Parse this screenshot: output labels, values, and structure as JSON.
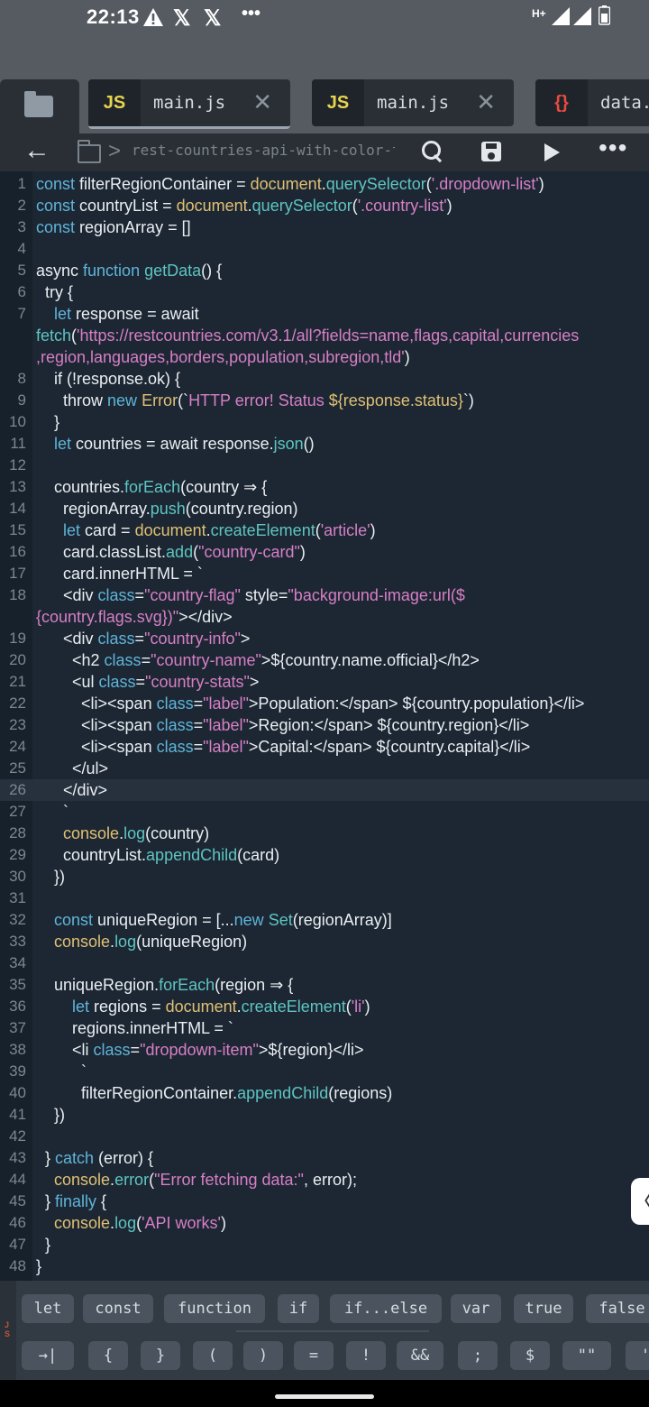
{
  "status_bar": {
    "time": "22:13",
    "icons": [
      "warning-icon",
      "x-app-icon",
      "x-app-icon",
      "more-dots-icon",
      "data-arrows-icon",
      "signal-icon",
      "signal-icon",
      "battery-icon"
    ],
    "more": "•••",
    "network": "H+"
  },
  "tabs": [
    {
      "type": "JS",
      "name": "main.js",
      "close": "✕"
    },
    {
      "type": "JS",
      "name": "main.js",
      "close": "✕"
    },
    {
      "type": "{}",
      "name": "data."
    }
  ],
  "toolbar": {
    "back": "←",
    "chevron": ">",
    "path": "rest-countries-api-with-color-theme-switcher",
    "more": "•••"
  },
  "code_lines": [
    {
      "n": "1",
      "tokens": [
        [
          "const ",
          "kw"
        ],
        [
          "filterRegionContainer = ",
          "pl"
        ],
        [
          "document",
          "obj"
        ],
        [
          ".",
          "pl"
        ],
        [
          "querySelector",
          "fn"
        ],
        [
          "(",
          "pl"
        ],
        [
          "'.dropdown-list'",
          "str"
        ],
        [
          ")",
          "pl"
        ]
      ]
    },
    {
      "n": "2",
      "tokens": [
        [
          "const ",
          "kw"
        ],
        [
          "countryList = ",
          "pl"
        ],
        [
          "document",
          "obj"
        ],
        [
          ".",
          "pl"
        ],
        [
          "querySelector",
          "fn"
        ],
        [
          "(",
          "pl"
        ],
        [
          "'.country-list'",
          "str"
        ],
        [
          ")",
          "pl"
        ]
      ]
    },
    {
      "n": "3",
      "tokens": [
        [
          "const ",
          "kw"
        ],
        [
          "regionArray = []",
          "pl"
        ]
      ]
    },
    {
      "n": "4",
      "tokens": []
    },
    {
      "n": "5",
      "tokens": [
        [
          "async ",
          "pl"
        ],
        [
          "function ",
          "kw"
        ],
        [
          "getData",
          "fn"
        ],
        [
          "() {",
          "pl"
        ]
      ]
    },
    {
      "n": "6",
      "tokens": [
        [
          "  try {",
          "pl"
        ]
      ]
    },
    {
      "n": "7",
      "tokens": [
        [
          "    let ",
          "kw"
        ],
        [
          "response = await",
          "pl"
        ]
      ]
    },
    {
      "n": "",
      "tokens": [
        [
          "fetch",
          "fn"
        ],
        [
          "(",
          "pl"
        ],
        [
          "'https://restcountries.com/v3.1/all?fields=name,flags,capital,currencies",
          "str"
        ]
      ]
    },
    {
      "n": "",
      "tokens": [
        [
          ",region,languages,borders,population,subregion,tld'",
          "str"
        ],
        [
          ")",
          "pl"
        ]
      ]
    },
    {
      "n": "8",
      "tokens": [
        [
          "    if (!response.ok) {",
          "pl"
        ]
      ]
    },
    {
      "n": "9",
      "tokens": [
        [
          "      throw ",
          "pl"
        ],
        [
          "new ",
          "kw"
        ],
        [
          "Error",
          "obj"
        ],
        [
          "(`",
          "pl"
        ],
        [
          "HTTP error! Status ",
          "str"
        ],
        [
          "${response.status}",
          "obj"
        ],
        [
          "`)",
          "pl"
        ]
      ]
    },
    {
      "n": "10",
      "tokens": [
        [
          "    }",
          "pl"
        ]
      ]
    },
    {
      "n": "11",
      "tokens": [
        [
          "    let ",
          "kw"
        ],
        [
          "countries = await response.",
          "pl"
        ],
        [
          "json",
          "fn"
        ],
        [
          "()",
          "pl"
        ]
      ]
    },
    {
      "n": "12",
      "tokens": []
    },
    {
      "n": "13",
      "tokens": [
        [
          "    countries.",
          "pl"
        ],
        [
          "forEach",
          "fn"
        ],
        [
          "(country ⇒ {",
          "pl"
        ]
      ]
    },
    {
      "n": "14",
      "tokens": [
        [
          "      regionArray.",
          "pl"
        ],
        [
          "push",
          "fn"
        ],
        [
          "(country.region)",
          "pl"
        ]
      ]
    },
    {
      "n": "15",
      "tokens": [
        [
          "      let ",
          "kw"
        ],
        [
          "card = ",
          "pl"
        ],
        [
          "document",
          "obj"
        ],
        [
          ".",
          "pl"
        ],
        [
          "createElement",
          "fn"
        ],
        [
          "(",
          "pl"
        ],
        [
          "'article'",
          "str"
        ],
        [
          ")",
          "pl"
        ]
      ]
    },
    {
      "n": "16",
      "tokens": [
        [
          "      card.classList.",
          "pl"
        ],
        [
          "add",
          "fn"
        ],
        [
          "(",
          "pl"
        ],
        [
          "\"country-card\"",
          "str"
        ],
        [
          ")",
          "pl"
        ]
      ]
    },
    {
      "n": "17",
      "tokens": [
        [
          "      card.innerHTML = `",
          "pl"
        ]
      ]
    },
    {
      "n": "18",
      "tokens": [
        [
          "      <div ",
          "pl"
        ],
        [
          "class",
          "kw"
        ],
        [
          "=",
          "pl"
        ],
        [
          "\"country-flag\" ",
          "str"
        ],
        [
          "style",
          "pl"
        ],
        [
          "=",
          "pl"
        ],
        [
          "\"background-image:url($",
          "str"
        ]
      ]
    },
    {
      "n": "",
      "tokens": [
        [
          "{country.flags.svg})\"",
          "str"
        ],
        [
          "></div>",
          "pl"
        ]
      ]
    },
    {
      "n": "19",
      "tokens": [
        [
          "      <div ",
          "pl"
        ],
        [
          "class",
          "kw"
        ],
        [
          "=",
          "pl"
        ],
        [
          "\"country-info\"",
          "str"
        ],
        [
          ">",
          "pl"
        ]
      ]
    },
    {
      "n": "20",
      "tokens": [
        [
          "        <h2 ",
          "pl"
        ],
        [
          "class",
          "kw"
        ],
        [
          "=",
          "pl"
        ],
        [
          "\"country-name\"",
          "str"
        ],
        [
          ">${country.name.official}</h2>",
          "pl"
        ]
      ]
    },
    {
      "n": "21",
      "tokens": [
        [
          "        <ul ",
          "pl"
        ],
        [
          "class",
          "kw"
        ],
        [
          "=",
          "pl"
        ],
        [
          "\"country-stats\"",
          "str"
        ],
        [
          ">",
          "pl"
        ]
      ]
    },
    {
      "n": "22",
      "tokens": [
        [
          "          <li><span ",
          "pl"
        ],
        [
          "class",
          "kw"
        ],
        [
          "=",
          "pl"
        ],
        [
          "\"label\"",
          "str"
        ],
        [
          ">Population:</span> ${country.population}</li>",
          "pl"
        ]
      ]
    },
    {
      "n": "23",
      "tokens": [
        [
          "          <li><span ",
          "pl"
        ],
        [
          "class",
          "kw"
        ],
        [
          "=",
          "pl"
        ],
        [
          "\"label\"",
          "str"
        ],
        [
          ">Region:</span> ${country.region}</li>",
          "pl"
        ]
      ]
    },
    {
      "n": "24",
      "tokens": [
        [
          "          <li><span ",
          "pl"
        ],
        [
          "class",
          "kw"
        ],
        [
          "=",
          "pl"
        ],
        [
          "\"label\"",
          "str"
        ],
        [
          ">Capital:</span> ${country.capital}</li>",
          "pl"
        ]
      ]
    },
    {
      "n": "25",
      "tokens": [
        [
          "        </ul>",
          "pl"
        ]
      ]
    },
    {
      "n": "26",
      "tokens": [
        [
          "      </div>",
          "pl"
        ]
      ],
      "current": true
    },
    {
      "n": "27",
      "tokens": [
        [
          "      `",
          "pl"
        ]
      ]
    },
    {
      "n": "28",
      "tokens": [
        [
          "      console",
          "obj"
        ],
        [
          ".",
          "pl"
        ],
        [
          "log",
          "fn"
        ],
        [
          "(country)",
          "pl"
        ]
      ]
    },
    {
      "n": "29",
      "tokens": [
        [
          "      countryList.",
          "pl"
        ],
        [
          "appendChild",
          "fn"
        ],
        [
          "(card)",
          "pl"
        ]
      ]
    },
    {
      "n": "30",
      "tokens": [
        [
          "    })",
          "pl"
        ]
      ]
    },
    {
      "n": "31",
      "tokens": []
    },
    {
      "n": "32",
      "tokens": [
        [
          "    const ",
          "kw"
        ],
        [
          "uniqueRegion = [...",
          "pl"
        ],
        [
          "new ",
          "kw"
        ],
        [
          "Set",
          "fn"
        ],
        [
          "(regionArray)]",
          "pl"
        ]
      ]
    },
    {
      "n": "33",
      "tokens": [
        [
          "    console",
          "obj"
        ],
        [
          ".",
          "pl"
        ],
        [
          "log",
          "fn"
        ],
        [
          "(uniqueRegion)",
          "pl"
        ]
      ]
    },
    {
      "n": "34",
      "tokens": []
    },
    {
      "n": "35",
      "tokens": [
        [
          "    uniqueRegion.",
          "pl"
        ],
        [
          "forEach",
          "fn"
        ],
        [
          "(region ⇒ {",
          "pl"
        ]
      ]
    },
    {
      "n": "36",
      "tokens": [
        [
          "        let ",
          "kw"
        ],
        [
          "regions = ",
          "pl"
        ],
        [
          "document",
          "obj"
        ],
        [
          ".",
          "pl"
        ],
        [
          "createElement",
          "fn"
        ],
        [
          "(",
          "pl"
        ],
        [
          "'li'",
          "str"
        ],
        [
          ")",
          "pl"
        ]
      ]
    },
    {
      "n": "37",
      "tokens": [
        [
          "        regions.innerHTML = `",
          "pl"
        ]
      ]
    },
    {
      "n": "38",
      "tokens": [
        [
          "        <li ",
          "pl"
        ],
        [
          "class",
          "kw"
        ],
        [
          "=",
          "pl"
        ],
        [
          "\"dropdown-item\"",
          "str"
        ],
        [
          ">${region}</li>",
          "pl"
        ]
      ]
    },
    {
      "n": "39",
      "tokens": [
        [
          "          `",
          "pl"
        ]
      ]
    },
    {
      "n": "40",
      "tokens": [
        [
          "          filterRegionContainer.",
          "pl"
        ],
        [
          "appendChild",
          "fn"
        ],
        [
          "(regions)",
          "pl"
        ]
      ]
    },
    {
      "n": "41",
      "tokens": [
        [
          "    })",
          "pl"
        ]
      ]
    },
    {
      "n": "42",
      "tokens": []
    },
    {
      "n": "43",
      "tokens": [
        [
          "  } ",
          "pl"
        ],
        [
          "catch ",
          "kw"
        ],
        [
          "(error) {",
          "pl"
        ]
      ]
    },
    {
      "n": "44",
      "tokens": [
        [
          "    console",
          "obj"
        ],
        [
          ".",
          "pl"
        ],
        [
          "error",
          "fn"
        ],
        [
          "(",
          "pl"
        ],
        [
          "\"Error fetching data:\"",
          "str"
        ],
        [
          ", error);",
          "pl"
        ]
      ]
    },
    {
      "n": "45",
      "tokens": [
        [
          "  } ",
          "pl"
        ],
        [
          "finally ",
          "kw"
        ],
        [
          "{",
          "pl"
        ]
      ]
    },
    {
      "n": "46",
      "tokens": [
        [
          "    console",
          "obj"
        ],
        [
          ".",
          "pl"
        ],
        [
          "log",
          "fn"
        ],
        [
          "(",
          "pl"
        ],
        [
          "'API works'",
          "str"
        ],
        [
          ")",
          "pl"
        ]
      ]
    },
    {
      "n": "47",
      "tokens": [
        [
          "  }",
          "pl"
        ]
      ]
    },
    {
      "n": "48",
      "tokens": [
        [
          "}",
          "pl"
        ]
      ]
    }
  ],
  "side_handle": "〈",
  "keybar": {
    "side_label": "J\nS",
    "snippets": [
      "let",
      "const",
      "function",
      "if",
      "if...else",
      "var",
      "true",
      "false"
    ],
    "symbols": [
      "→|",
      "{",
      "}",
      "(",
      ")",
      "=",
      "!",
      "&&",
      ";",
      "$",
      "\"\"",
      "'"
    ]
  }
}
